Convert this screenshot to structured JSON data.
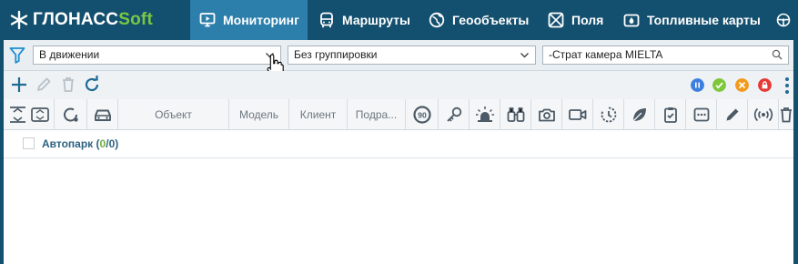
{
  "app": {
    "logo_main": "ГЛОНАСС",
    "logo_accent": "Soft",
    "brand_color": "#134f6e",
    "active_color": "#2c7fab",
    "accent_green": "#79c744"
  },
  "nav": {
    "tabs": [
      {
        "label": "Мониторинг",
        "icon": "monitor-icon",
        "active": true
      },
      {
        "label": "Маршруты",
        "icon": "bus-icon",
        "active": false
      },
      {
        "label": "Геообъекты",
        "icon": "globe-icon",
        "active": false
      },
      {
        "label": "Поля",
        "icon": "field-icon",
        "active": false
      },
      {
        "label": "Топливные карты",
        "icon": "fuel-card-icon",
        "active": false
      }
    ],
    "more_icon": "steering-wheel-icon"
  },
  "filters": {
    "filter_icon": "filter-icon",
    "state_select": "В движении",
    "group_select": "Без группировки",
    "search_value": "-Страт камера MIELTA",
    "search_icon": "search-icon"
  },
  "toolbar": {
    "actions": [
      "add-icon",
      "edit-icon",
      "delete-icon",
      "refresh-icon"
    ],
    "status_filters": [
      {
        "name": "pause",
        "color": "#3d7fe0"
      },
      {
        "name": "ok",
        "color": "#7ec63a"
      },
      {
        "name": "tools",
        "color": "#f29a1c"
      },
      {
        "name": "locked",
        "color": "#e53935"
      }
    ]
  },
  "table": {
    "columns": {
      "object": "Объект",
      "model": "Модель",
      "client": "Клиент",
      "division": "Подра..."
    },
    "speed_badge": "90",
    "groups": [
      {
        "name": "Автопарк",
        "open_paren": "(",
        "active": "0",
        "separator": "/",
        "total": "0",
        "close_paren": ")"
      }
    ]
  }
}
